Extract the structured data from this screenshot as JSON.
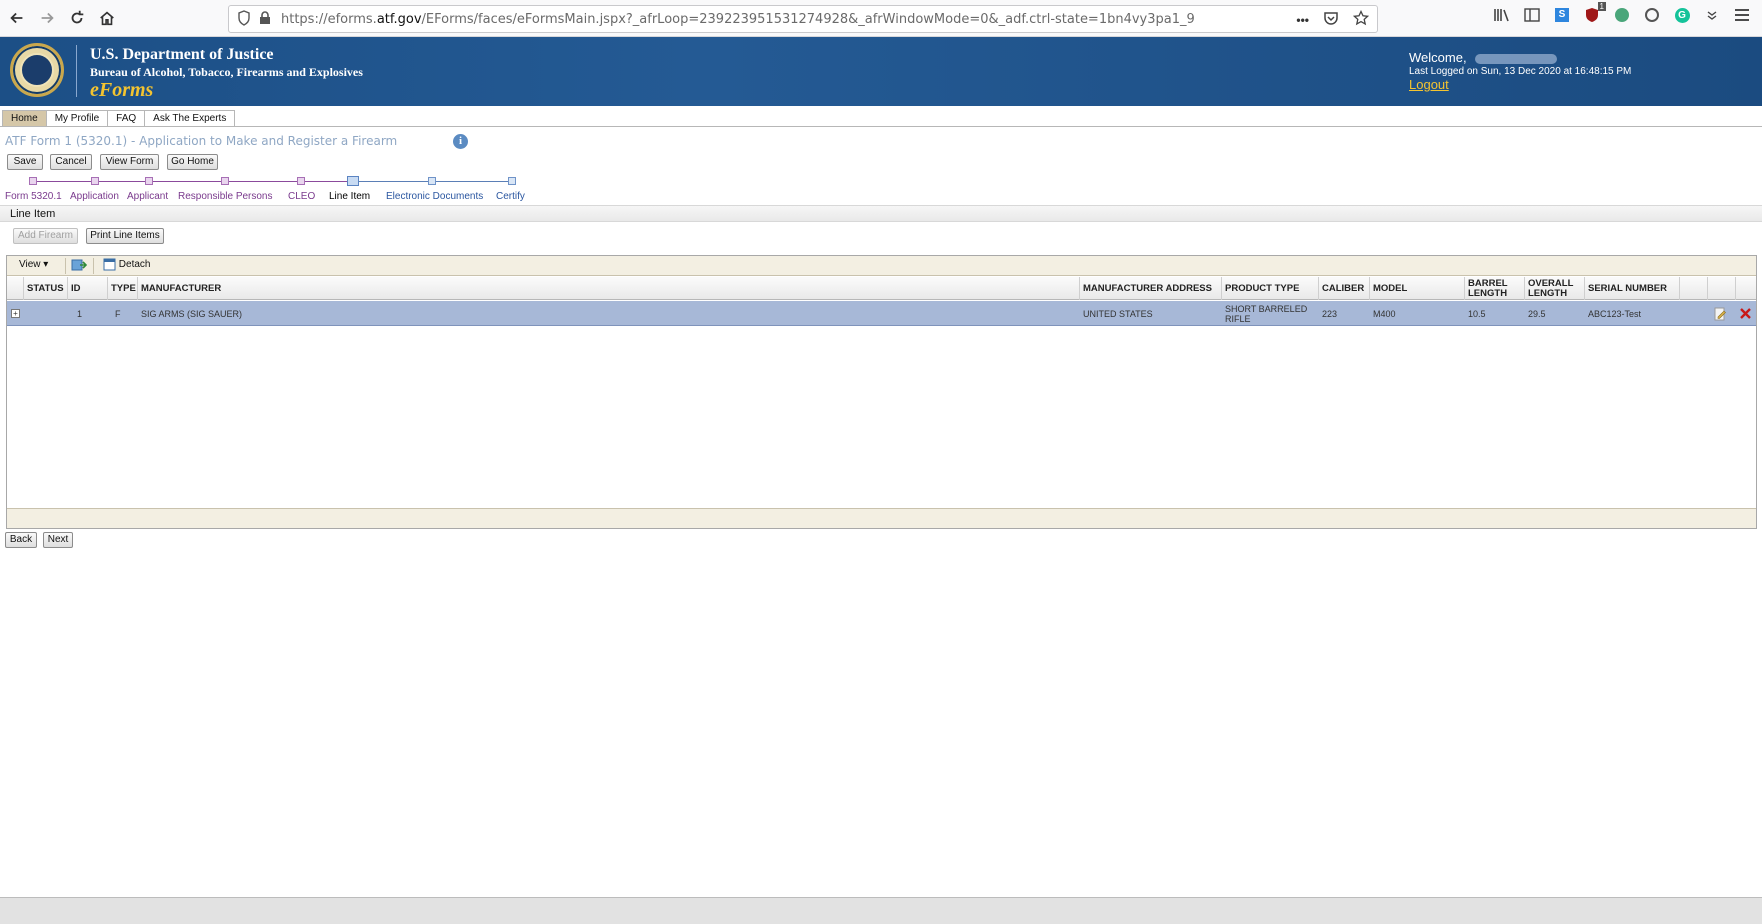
{
  "browser": {
    "url_prefix": "https://eforms.",
    "url_domain": "atf.gov",
    "url_path": "/EForms/faces/eFormsMain.jspx?_afrLoop=239223951531274928&_afrWindowMode=0&_adf.ctrl-state=1bn4vy3pa1_9",
    "more_label": "•••",
    "ublock_badge": "1"
  },
  "header": {
    "department": "U.S. Department of Justice",
    "bureau": "Bureau of Alcohol, Tobacco, Firearms and Explosives",
    "app_name": "eForms",
    "welcome": "Welcome,",
    "last_logged": "Last Logged on Sun, 13 Dec 2020 at 16:48:15 PM",
    "logout": "Logout"
  },
  "menu": {
    "tabs": [
      "Home",
      "My Profile",
      "FAQ",
      "Ask The Experts"
    ]
  },
  "form": {
    "title": "ATF Form 1 (5320.1) - Application to Make and Register a Firearm",
    "info": "i",
    "buttons": {
      "save": "Save",
      "cancel": "Cancel",
      "view_form": "View Form",
      "go_home": "Go Home"
    }
  },
  "train": {
    "steps": [
      "Form 5320.1",
      "Application",
      "Applicant",
      "Responsible Persons",
      "CLEO",
      "Line Item",
      "Electronic Documents",
      "Certify"
    ],
    "current": "Line Item"
  },
  "section": {
    "title": "Line Item",
    "add_firearm": "Add Firearm",
    "print_line_items": "Print Line Items"
  },
  "table": {
    "toolbar": {
      "view": "View",
      "detach": "Detach"
    },
    "columns": [
      "STATUS",
      "ID",
      "TYPE",
      "MANUFACTURER",
      "MANUFACTURER ADDRESS",
      "PRODUCT TYPE",
      "CALIBER",
      "MODEL",
      "BARREL LENGTH",
      "OVERALL LENGTH",
      "SERIAL NUMBER"
    ],
    "rows": [
      {
        "expand": "+",
        "status": "",
        "id": "1",
        "type": "F",
        "manufacturer": "SIG ARMS (SIG SAUER)",
        "manufacturer_address": "UNITED STATES",
        "product_type": "SHORT BARRELED RIFLE",
        "caliber": "223",
        "model": "M400",
        "barrel_length": "10.5",
        "overall_length": "29.5",
        "serial_number": "ABC123-Test"
      }
    ]
  },
  "nav": {
    "back": "Back",
    "next": "Next"
  },
  "colors": {
    "header_blue": "#1c4f86",
    "accent_gold": "#f4c430",
    "selected_row": "#a7b8d7",
    "train_done": "#7a3a8d",
    "train_future": "#2a56a0"
  }
}
